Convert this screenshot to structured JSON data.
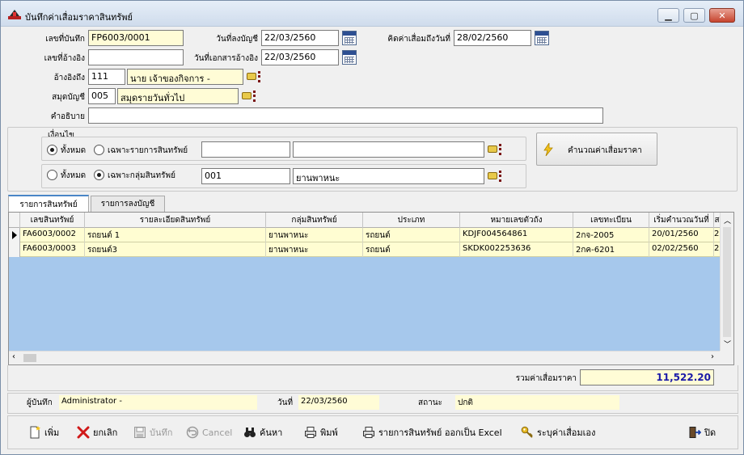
{
  "window": {
    "title": "บันทึกค่าเสื่อมราคาสินทรัพย์"
  },
  "form": {
    "doc_no_label": "เลขที่บันทึก",
    "doc_no": "FP6003/0001",
    "post_date_label": "วันที่ลงบัญชี",
    "post_date": "22/03/2560",
    "calc_to_label": "คิดค่าเสื่อมถึงวันที่",
    "calc_to": "28/02/2560",
    "ref_no_label": "เลขที่อ้างอิง",
    "ref_no": "",
    "ref_date_label": "วันที่เอกสารอ้างอิง",
    "ref_date": "22/03/2560",
    "ref_to_label": "อ้างอิงถึง",
    "ref_to_code": "111",
    "ref_to_name": "นาย เจ้าของกิจการ -",
    "journal_label": "สมุดบัญชี",
    "journal_code": "005",
    "journal_name": "สมุดรายวันทั่วไป",
    "desc_label": "คำอธิบาย",
    "desc": ""
  },
  "conditions": {
    "group_title": "เงื่อนไข",
    "row1_all_label": "ทั้งหมด",
    "row1_specific_label": "เฉพาะรายการสินทรัพย์",
    "row1_code": "",
    "row1_name": "",
    "row2_all_label": "ทั้งหมด",
    "row2_specific_label": "เฉพาะกลุ่มสินทรัพย์",
    "row2_code": "001",
    "row2_name": "ยานพาหนะ",
    "calc_button": "คำนวณค่าเสื่อมราคา"
  },
  "tabs": [
    {
      "label": "รายการสินทรัพย์",
      "active": true
    },
    {
      "label": "รายการลงบัญชี",
      "active": false
    }
  ],
  "grid": {
    "columns": [
      "เลขสินทรัพย์",
      "รายละเอียดสินทรัพย์",
      "กลุ่มสินทรัพย์",
      "ประเภท",
      "หมายเลขตัวถัง",
      "เลขทะเบียน",
      "เริ่มคำนวณวันที่",
      "ส"
    ],
    "rows": [
      [
        "FA6003/0002",
        "รถยนต์ 1",
        "ยานพาหนะ",
        "รถยนต์",
        "KDJF004564861",
        "2กจ-2005",
        "20/01/2560",
        "2"
      ],
      [
        "FA6003/0003",
        "รถยนต์3",
        "ยานพาหนะ",
        "รถยนต์",
        "SKDK002253636",
        "2กค-6201",
        "02/02/2560",
        "2"
      ]
    ]
  },
  "total": {
    "label": "รวมค่าเสื่อมราคา",
    "value": "11,522.20",
    "color": "#1a1aa8"
  },
  "footer": {
    "recorder_label": "ผู้บันทึก",
    "recorder": "Administrator -",
    "date_label": "วันที่",
    "date": "22/03/2560",
    "status_label": "สถานะ",
    "status": "ปกติ"
  },
  "toolbar": {
    "add": "เพิ่ม",
    "cancel_doc": "ยกเลิก",
    "save": "บันทึก",
    "cancel": "Cancel",
    "search": "ค้นหา",
    "print": "พิมพ์",
    "export": "รายการสินทรัพย์ ออกเป็น Excel",
    "set_dep": "ระบุค่าเสื่อมเอง",
    "close": "ปิด"
  }
}
